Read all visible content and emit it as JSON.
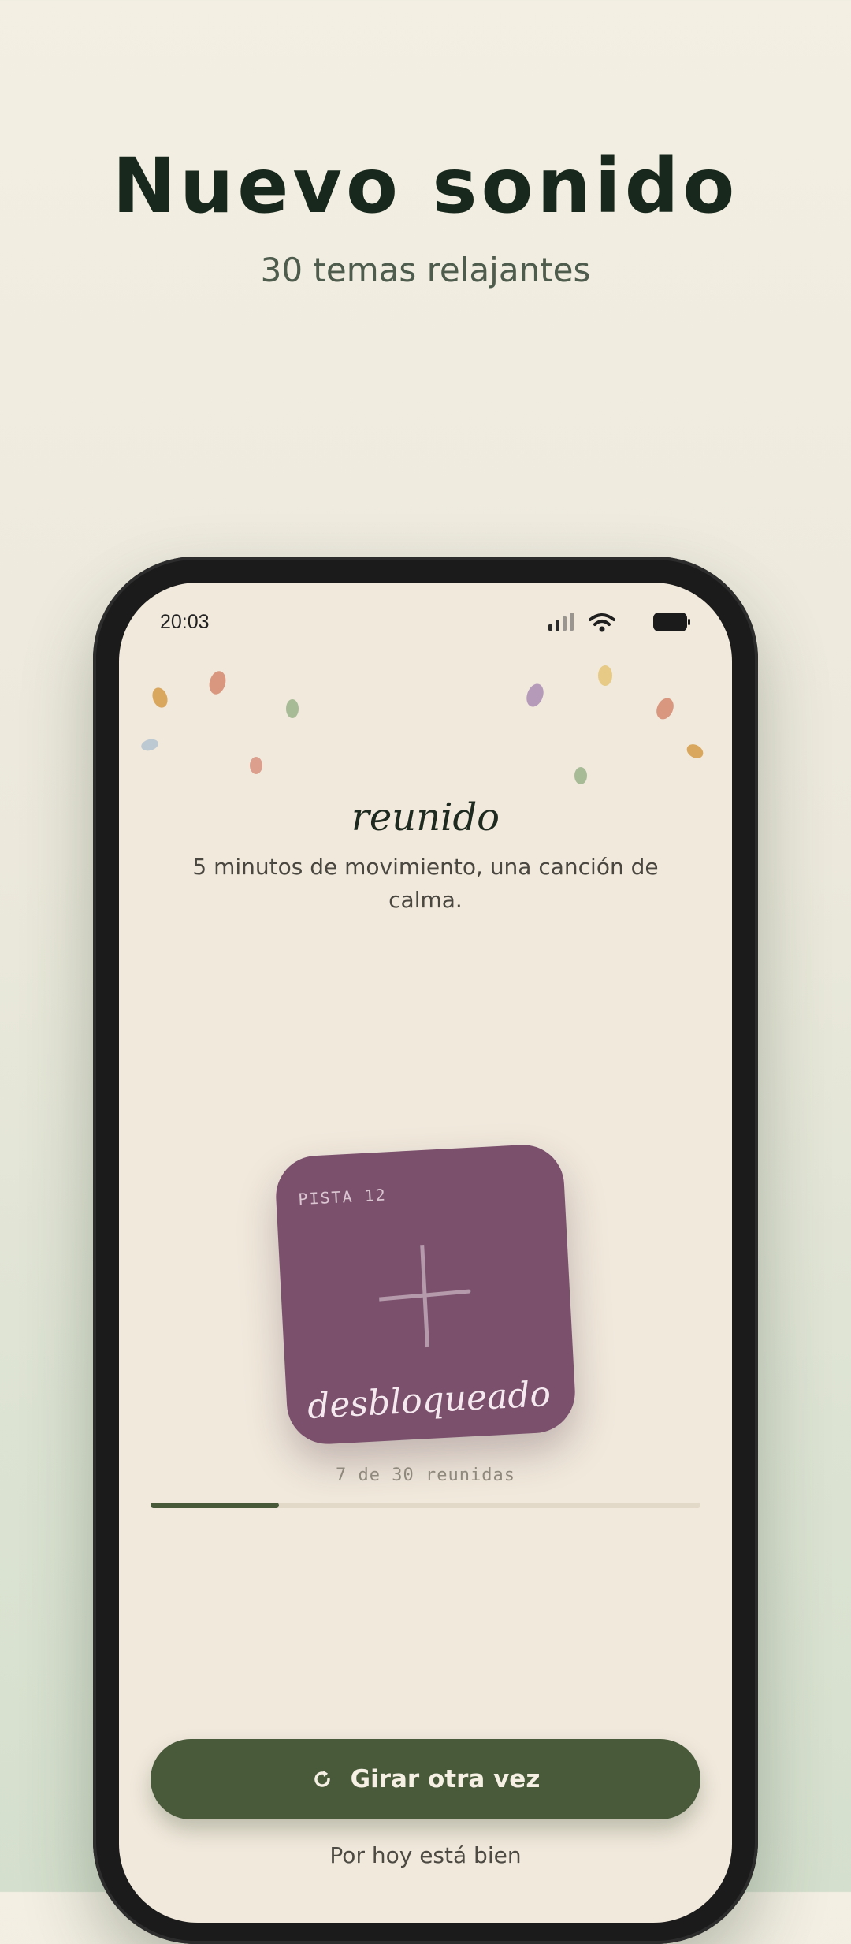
{
  "hero": {
    "title": "Nuevo sonido",
    "subtitle": "30 temas relajantes"
  },
  "status_bar": {
    "time": "20:03",
    "icons": [
      "signal-icon",
      "wifi-icon",
      "battery-icon"
    ]
  },
  "celebration": {
    "headline": "reunido",
    "description": "5 minutos de movimiento, una canción de calma."
  },
  "card": {
    "tag": "PISTA 12",
    "word": "desbloqueado",
    "icon": "plus-icon",
    "color": "#7a506c"
  },
  "progress": {
    "label": "7 de 30 reunidas",
    "collected": 7,
    "total": 30
  },
  "actions": {
    "primary_label": "Girar otra vez",
    "primary_icon": "refresh-icon",
    "secondary_label": "Por hoy está bien"
  },
  "colors": {
    "accent": "#485a3a",
    "screen_background": "#f1e9dc",
    "title": "#18281c"
  }
}
